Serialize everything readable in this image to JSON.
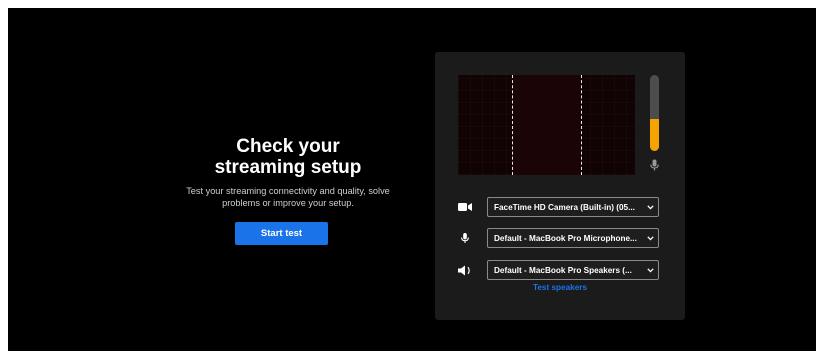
{
  "intro": {
    "headline_line1": "Check your",
    "headline_line2": "streaming setup",
    "description_line1": "Test your streaming connectivity and quality, solve",
    "description_line2": "problems or improve your setup.",
    "start_button": "Start test"
  },
  "preview": {
    "icons": {
      "meter": "microphone-icon"
    },
    "mic_level_percent": 42,
    "colors": {
      "level": "#f5a300",
      "track": "#4d4d4d",
      "video_bg": "#110304"
    }
  },
  "devices": {
    "camera": {
      "icon": "video-camera-icon",
      "selected": "FaceTime HD Camera (Built-in) (05..."
    },
    "microphone": {
      "icon": "microphone-icon",
      "selected": "Default - MacBook Pro Microphone..."
    },
    "speakers": {
      "icon": "speaker-icon",
      "selected": "Default - MacBook Pro Speakers (..."
    }
  },
  "actions": {
    "test_speakers": "Test speakers"
  },
  "colors": {
    "accent": "#1a73e8",
    "background": "#000000",
    "panel": "#1b1b1b"
  }
}
